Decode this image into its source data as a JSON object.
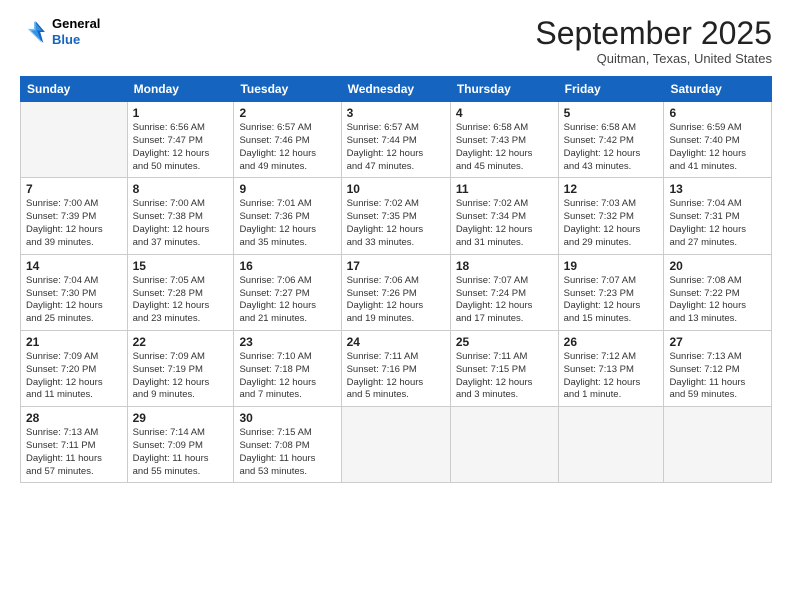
{
  "logo": {
    "line1": "General",
    "line2": "Blue"
  },
  "title": "September 2025",
  "location": "Quitman, Texas, United States",
  "days_of_week": [
    "Sunday",
    "Monday",
    "Tuesday",
    "Wednesday",
    "Thursday",
    "Friday",
    "Saturday"
  ],
  "weeks": [
    [
      {
        "day": "",
        "info": ""
      },
      {
        "day": "1",
        "info": "Sunrise: 6:56 AM\nSunset: 7:47 PM\nDaylight: 12 hours\nand 50 minutes."
      },
      {
        "day": "2",
        "info": "Sunrise: 6:57 AM\nSunset: 7:46 PM\nDaylight: 12 hours\nand 49 minutes."
      },
      {
        "day": "3",
        "info": "Sunrise: 6:57 AM\nSunset: 7:44 PM\nDaylight: 12 hours\nand 47 minutes."
      },
      {
        "day": "4",
        "info": "Sunrise: 6:58 AM\nSunset: 7:43 PM\nDaylight: 12 hours\nand 45 minutes."
      },
      {
        "day": "5",
        "info": "Sunrise: 6:58 AM\nSunset: 7:42 PM\nDaylight: 12 hours\nand 43 minutes."
      },
      {
        "day": "6",
        "info": "Sunrise: 6:59 AM\nSunset: 7:40 PM\nDaylight: 12 hours\nand 41 minutes."
      }
    ],
    [
      {
        "day": "7",
        "info": "Sunrise: 7:00 AM\nSunset: 7:39 PM\nDaylight: 12 hours\nand 39 minutes."
      },
      {
        "day": "8",
        "info": "Sunrise: 7:00 AM\nSunset: 7:38 PM\nDaylight: 12 hours\nand 37 minutes."
      },
      {
        "day": "9",
        "info": "Sunrise: 7:01 AM\nSunset: 7:36 PM\nDaylight: 12 hours\nand 35 minutes."
      },
      {
        "day": "10",
        "info": "Sunrise: 7:02 AM\nSunset: 7:35 PM\nDaylight: 12 hours\nand 33 minutes."
      },
      {
        "day": "11",
        "info": "Sunrise: 7:02 AM\nSunset: 7:34 PM\nDaylight: 12 hours\nand 31 minutes."
      },
      {
        "day": "12",
        "info": "Sunrise: 7:03 AM\nSunset: 7:32 PM\nDaylight: 12 hours\nand 29 minutes."
      },
      {
        "day": "13",
        "info": "Sunrise: 7:04 AM\nSunset: 7:31 PM\nDaylight: 12 hours\nand 27 minutes."
      }
    ],
    [
      {
        "day": "14",
        "info": "Sunrise: 7:04 AM\nSunset: 7:30 PM\nDaylight: 12 hours\nand 25 minutes."
      },
      {
        "day": "15",
        "info": "Sunrise: 7:05 AM\nSunset: 7:28 PM\nDaylight: 12 hours\nand 23 minutes."
      },
      {
        "day": "16",
        "info": "Sunrise: 7:06 AM\nSunset: 7:27 PM\nDaylight: 12 hours\nand 21 minutes."
      },
      {
        "day": "17",
        "info": "Sunrise: 7:06 AM\nSunset: 7:26 PM\nDaylight: 12 hours\nand 19 minutes."
      },
      {
        "day": "18",
        "info": "Sunrise: 7:07 AM\nSunset: 7:24 PM\nDaylight: 12 hours\nand 17 minutes."
      },
      {
        "day": "19",
        "info": "Sunrise: 7:07 AM\nSunset: 7:23 PM\nDaylight: 12 hours\nand 15 minutes."
      },
      {
        "day": "20",
        "info": "Sunrise: 7:08 AM\nSunset: 7:22 PM\nDaylight: 12 hours\nand 13 minutes."
      }
    ],
    [
      {
        "day": "21",
        "info": "Sunrise: 7:09 AM\nSunset: 7:20 PM\nDaylight: 12 hours\nand 11 minutes."
      },
      {
        "day": "22",
        "info": "Sunrise: 7:09 AM\nSunset: 7:19 PM\nDaylight: 12 hours\nand 9 minutes."
      },
      {
        "day": "23",
        "info": "Sunrise: 7:10 AM\nSunset: 7:18 PM\nDaylight: 12 hours\nand 7 minutes."
      },
      {
        "day": "24",
        "info": "Sunrise: 7:11 AM\nSunset: 7:16 PM\nDaylight: 12 hours\nand 5 minutes."
      },
      {
        "day": "25",
        "info": "Sunrise: 7:11 AM\nSunset: 7:15 PM\nDaylight: 12 hours\nand 3 minutes."
      },
      {
        "day": "26",
        "info": "Sunrise: 7:12 AM\nSunset: 7:13 PM\nDaylight: 12 hours\nand 1 minute."
      },
      {
        "day": "27",
        "info": "Sunrise: 7:13 AM\nSunset: 7:12 PM\nDaylight: 11 hours\nand 59 minutes."
      }
    ],
    [
      {
        "day": "28",
        "info": "Sunrise: 7:13 AM\nSunset: 7:11 PM\nDaylight: 11 hours\nand 57 minutes."
      },
      {
        "day": "29",
        "info": "Sunrise: 7:14 AM\nSunset: 7:09 PM\nDaylight: 11 hours\nand 55 minutes."
      },
      {
        "day": "30",
        "info": "Sunrise: 7:15 AM\nSunset: 7:08 PM\nDaylight: 11 hours\nand 53 minutes."
      },
      {
        "day": "",
        "info": ""
      },
      {
        "day": "",
        "info": ""
      },
      {
        "day": "",
        "info": ""
      },
      {
        "day": "",
        "info": ""
      }
    ]
  ]
}
